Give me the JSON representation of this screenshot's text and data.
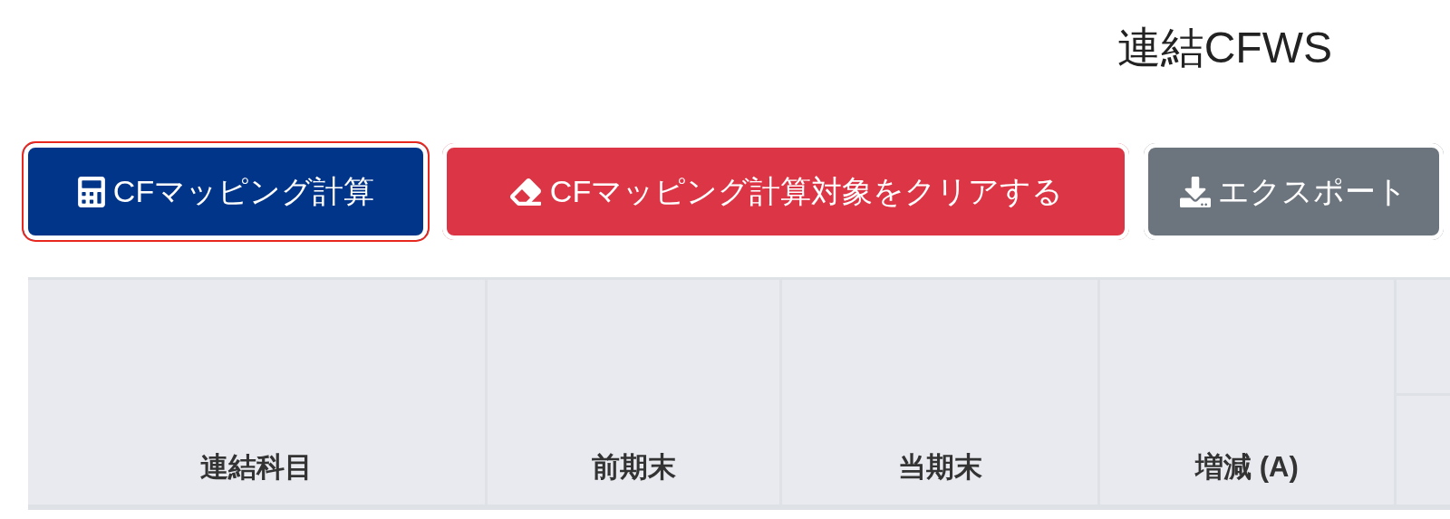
{
  "title": "連結CFWS",
  "buttons": [
    {
      "kind": "primary",
      "label": "CFマッピング計算",
      "focused": true
    },
    {
      "kind": "danger",
      "label": "CFマッピング計算対象をクリアする",
      "focused": false
    },
    {
      "kind": "secondary",
      "label": "エクスポート",
      "focused": false
    }
  ],
  "table": {
    "columns": [
      "連結科目",
      "前期末",
      "当期末",
      "増減 (A)"
    ]
  }
}
